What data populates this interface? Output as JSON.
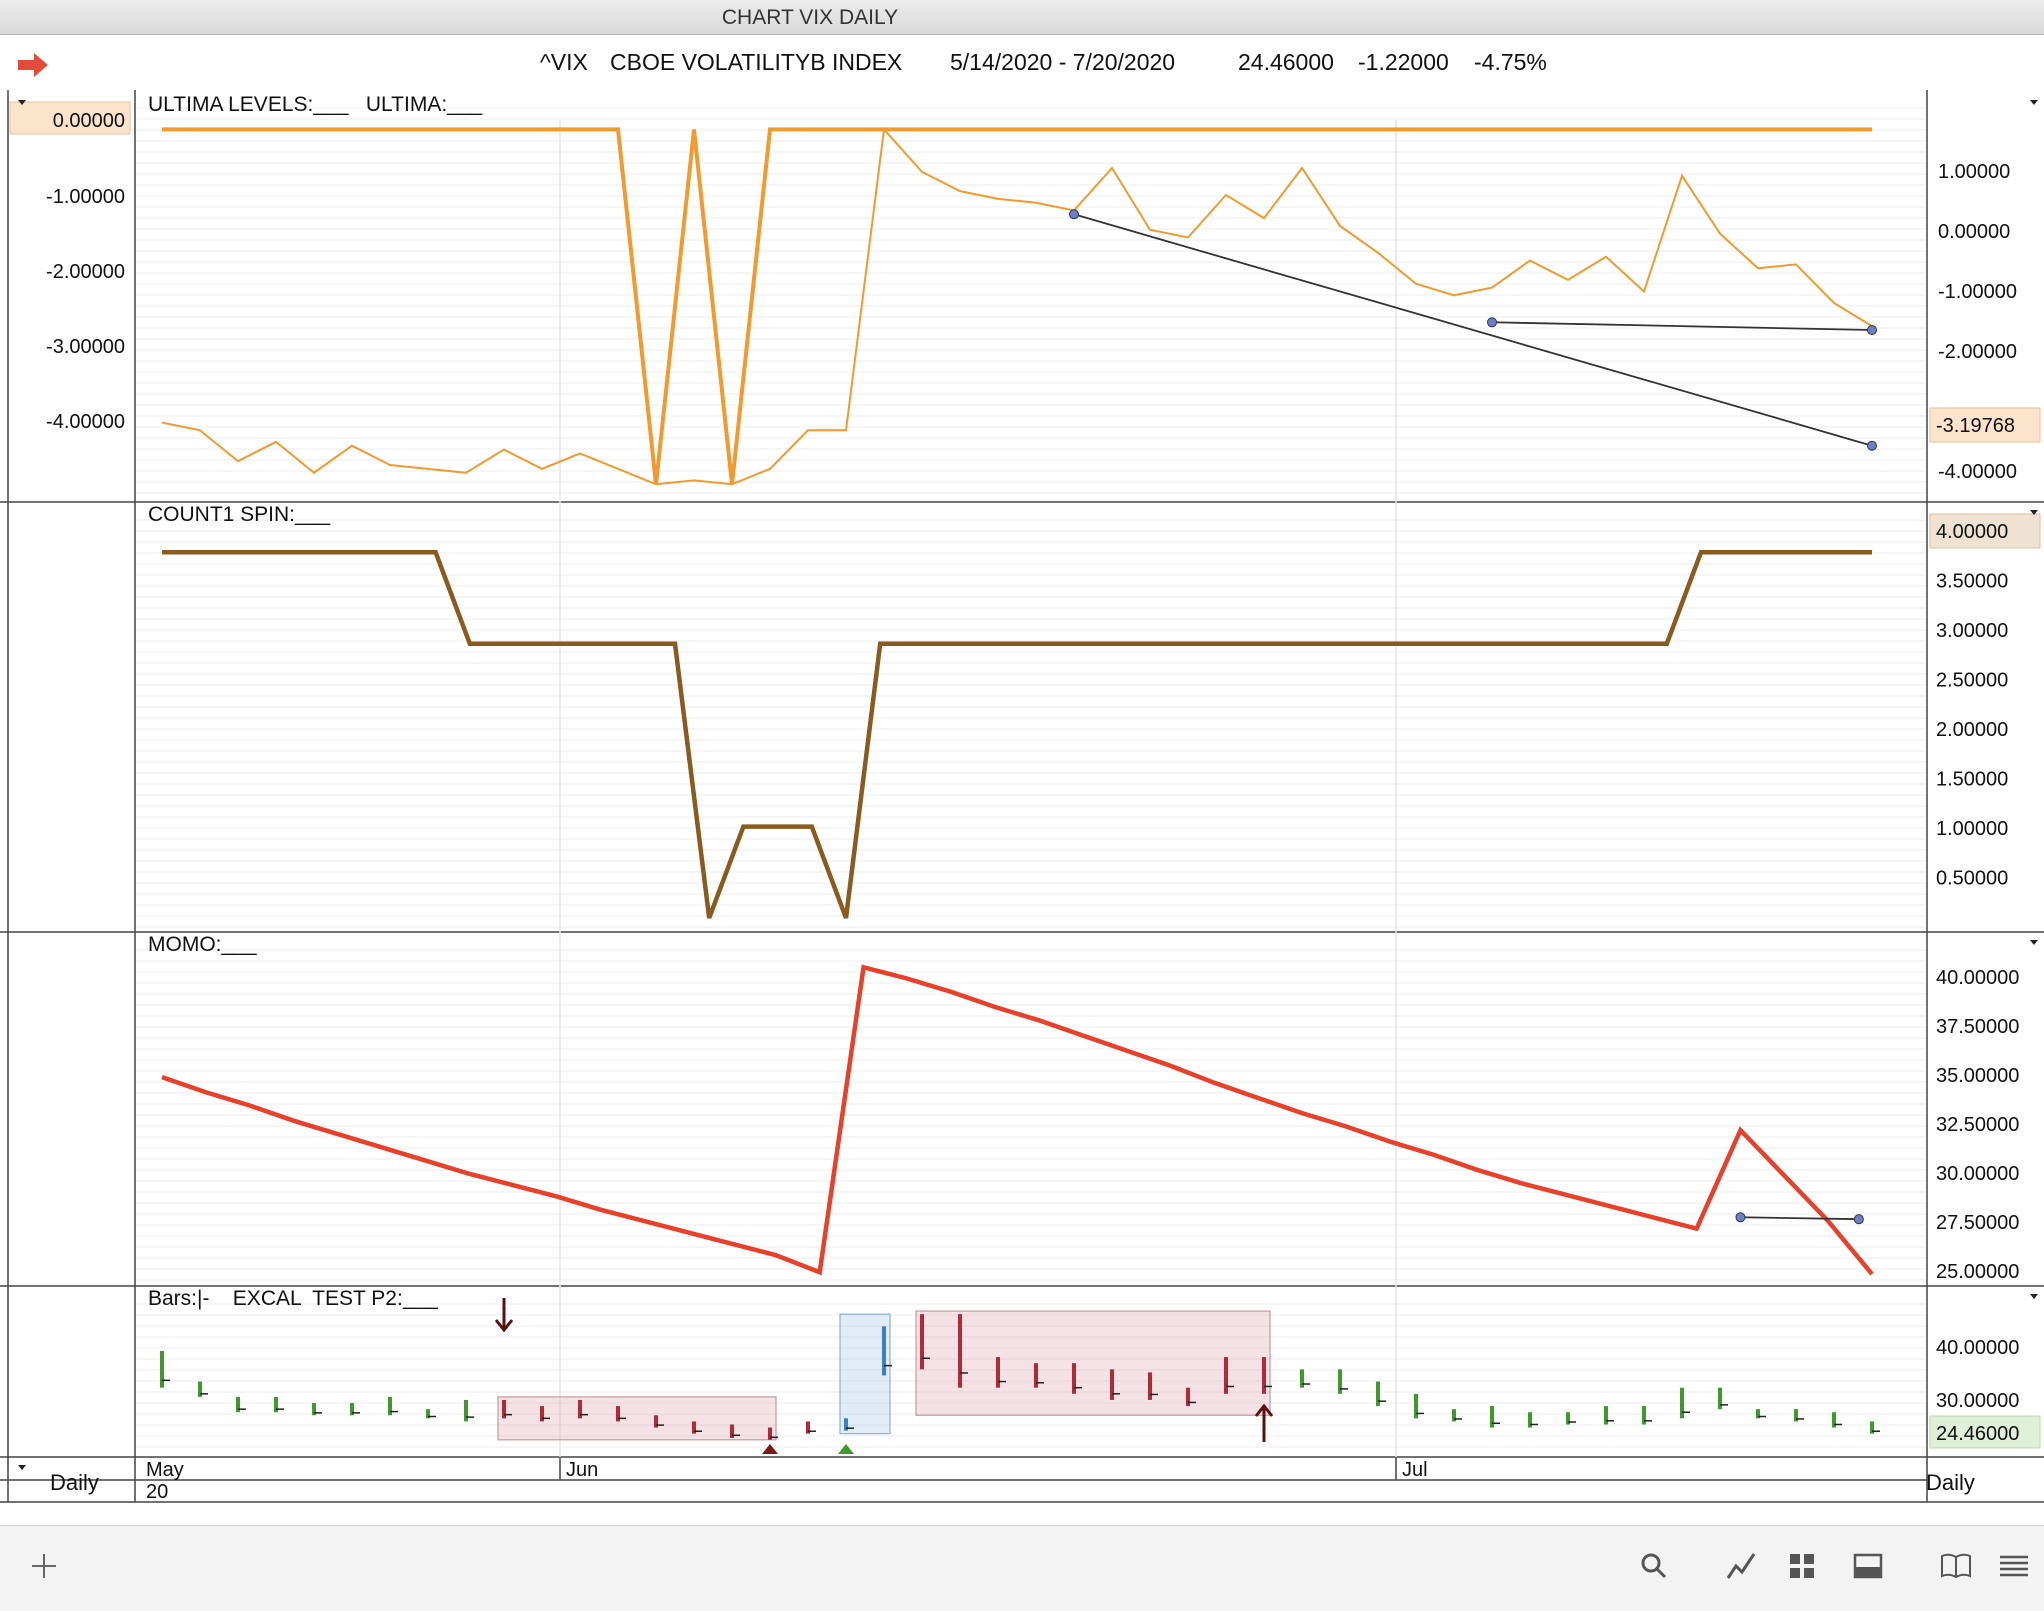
{
  "window": {
    "title": "CHART VIX DAILY"
  },
  "header": {
    "symbol": "^VIX",
    "name": "CBOE VOLATILITYB INDEX",
    "date_range": "5/14/2020 - 7/20/2020",
    "last": "24.46000",
    "change": "-1.22000",
    "change_pct": "-4.75%"
  },
  "colors": {
    "ultima": "#f39a2e",
    "count1": "#8a5a1e",
    "momo": "#e8402a",
    "bar_up": "#3f9a2e",
    "bar_down": "#b02a3a",
    "trendline": "#333333",
    "handle": "#6a7fc8"
  },
  "panels": {
    "ultima": {
      "legend": "ULTIMA LEVELS:___   ULTIMA:___",
      "left_axis": [
        "0.00000",
        "-1.00000",
        "-2.00000",
        "-3.00000",
        "-4.00000"
      ],
      "right_axis": [
        "1.00000",
        "0.00000",
        "-1.00000",
        "-2.00000",
        "-4.00000"
      ],
      "left_highlight": "0.00000",
      "right_highlight": "-3.19768"
    },
    "count1": {
      "legend": "COUNT1 SPIN:___",
      "right_axis": [
        "4.00000",
        "3.50000",
        "3.00000",
        "2.50000",
        "2.00000",
        "1.50000",
        "1.00000",
        "0.50000"
      ],
      "right_highlight": "4.00000"
    },
    "momo": {
      "legend": "MOMO:___",
      "right_axis": [
        "40.00000",
        "37.50000",
        "35.00000",
        "32.50000",
        "30.00000",
        "27.50000",
        "25.00000"
      ]
    },
    "bars": {
      "legend": "Bars:|-    EXCAL  TEST P2:___",
      "right_axis": [
        "40.00000",
        "30.00000"
      ],
      "right_highlight": "24.46000"
    }
  },
  "xaxis": {
    "labels": [
      "May\n20",
      "Jun",
      "Jul"
    ],
    "left_period": "Daily",
    "right_period": "Daily"
  },
  "chart_data": [
    {
      "type": "line",
      "title": "ULTIMA LEVELS / ULTIMA",
      "ylim": [
        -4.7,
        0.2
      ],
      "series": [
        {
          "name": "ULTIMA LEVELS",
          "values": [
            0,
            0,
            0,
            0,
            0,
            0,
            0,
            0,
            0,
            0,
            0,
            0,
            0,
            -4.6,
            0,
            -4.6,
            0,
            0,
            0,
            0,
            0,
            0,
            0,
            0,
            0,
            0,
            0,
            0,
            0,
            0,
            0,
            0,
            0,
            0,
            0,
            0,
            0,
            0,
            0,
            0,
            0,
            0,
            0,
            0,
            0,
            0
          ]
        },
        {
          "name": "ULTIMA",
          "values": [
            -3.8,
            -3.9,
            -4.3,
            -4.05,
            -4.45,
            -4.1,
            -4.35,
            -4.4,
            -4.45,
            -4.15,
            -4.4,
            -4.2,
            -4.4,
            -4.6,
            -4.55,
            -4.6,
            -4.4,
            -3.9,
            -3.9,
            0,
            -0.55,
            -0.8,
            -0.9,
            -0.95,
            -1.05,
            -0.5,
            -1.3,
            -1.4,
            -0.85,
            -1.15,
            -0.5,
            -1.25,
            -1.6,
            -2.0,
            -2.15,
            -2.05,
            -1.7,
            -1.95,
            -1.65,
            -2.1,
            -0.6,
            -1.35,
            -1.8,
            -1.75,
            -2.25,
            -2.55
          ]
        }
      ],
      "trendlines": [
        {
          "x": [
            24,
            47
          ],
          "y": [
            -1.1,
            -4.1
          ]
        },
        {
          "x": [
            35,
            47
          ],
          "y": [
            -2.5,
            -2.6
          ]
        }
      ]
    },
    {
      "type": "line",
      "title": "COUNT1 SPIN",
      "ylim": [
        0,
        4.2
      ],
      "series": [
        {
          "name": "COUNT1 SPIN",
          "values": [
            4,
            4,
            4,
            4,
            4,
            4,
            4,
            4,
            4,
            3,
            3,
            3,
            3,
            3,
            3,
            3,
            0,
            1,
            1,
            1,
            0,
            3,
            3,
            3,
            3,
            3,
            3,
            3,
            3,
            3,
            3,
            3,
            3,
            3,
            3,
            3,
            3,
            3,
            3,
            3,
            3,
            3,
            3,
            3,
            3,
            4,
            4,
            4,
            4,
            4,
            4
          ]
        }
      ]
    },
    {
      "type": "line",
      "title": "MOMO",
      "ylim": [
        24.5,
        41.5
      ],
      "series": [
        {
          "name": "MOMO",
          "values": [
            35,
            34.2,
            33.5,
            32.7,
            32.0,
            31.3,
            30.6,
            29.9,
            29.3,
            28.7,
            28.0,
            27.4,
            26.8,
            26.2,
            25.6,
            24.7,
            40.8,
            40.2,
            39.5,
            38.7,
            38.0,
            37.2,
            36.4,
            35.6,
            34.7,
            33.9,
            33.1,
            32.4,
            31.6,
            30.9,
            30.1,
            29.4,
            28.8,
            28.2,
            27.6,
            27.0,
            32.2,
            29.8,
            27.4,
            24.6
          ]
        }
      ],
      "trendlines": [
        {
          "x": [
            45,
            49
          ],
          "y": [
            27.6,
            27.5
          ]
        }
      ]
    },
    {
      "type": "bar",
      "title": "Bars / EXCAL TEST P2",
      "ylim": [
        23,
        46
      ],
      "x": [
        "5/14",
        "5/15",
        "5/18",
        "5/19",
        "5/20",
        "5/21",
        "5/22",
        "5/26",
        "5/27",
        "5/28",
        "5/29",
        "6/1",
        "6/2",
        "6/3",
        "6/4",
        "6/5",
        "6/8",
        "6/9",
        "6/10",
        "6/11",
        "6/12",
        "6/15",
        "6/16",
        "6/17",
        "6/18",
        "6/19",
        "6/22",
        "6/23",
        "6/24",
        "6/25",
        "6/26",
        "6/29",
        "6/30",
        "7/1",
        "7/2",
        "7/6",
        "7/7",
        "7/8",
        "7/9",
        "7/10",
        "7/13",
        "7/14",
        "7/15",
        "7/16",
        "7/17",
        "7/20"
      ],
      "series": [
        {
          "name": "High-Low",
          "values": [
            [
              33,
              39
            ],
            [
              31.5,
              34
            ],
            [
              29,
              31.5
            ],
            [
              29,
              31.5
            ],
            [
              28.5,
              30.5
            ],
            [
              28.5,
              30.5
            ],
            [
              28.5,
              31.5
            ],
            [
              28,
              29.5
            ],
            [
              27.5,
              31
            ],
            [
              28,
              31
            ],
            [
              27.5,
              30
            ],
            [
              28,
              31
            ],
            [
              27.5,
              30
            ],
            [
              26.5,
              28.5
            ],
            [
              25.5,
              27.5
            ],
            [
              24.8,
              27
            ],
            [
              24.5,
              26.5
            ],
            [
              25.5,
              27.5
            ],
            [
              26,
              28
            ],
            [
              35,
              43
            ],
            [
              36,
              45
            ],
            [
              33,
              45
            ],
            [
              33,
              38
            ],
            [
              33,
              37
            ],
            [
              32,
              37
            ],
            [
              31,
              36
            ],
            [
              31,
              35.5
            ],
            [
              30,
              33
            ],
            [
              32,
              38
            ],
            [
              32,
              38
            ],
            [
              33,
              36
            ],
            [
              32,
              36
            ],
            [
              30,
              34
            ],
            [
              28,
              32
            ],
            [
              27.5,
              29.5
            ],
            [
              26.5,
              30
            ],
            [
              26.5,
              29
            ],
            [
              27,
              29
            ],
            [
              27,
              30
            ],
            [
              27,
              30
            ],
            [
              28,
              33
            ],
            [
              29.5,
              33
            ],
            [
              28,
              29.5
            ],
            [
              27.5,
              29.5
            ],
            [
              26.5,
              29
            ],
            [
              25.5,
              27.5
            ]
          ]
        }
      ]
    }
  ]
}
